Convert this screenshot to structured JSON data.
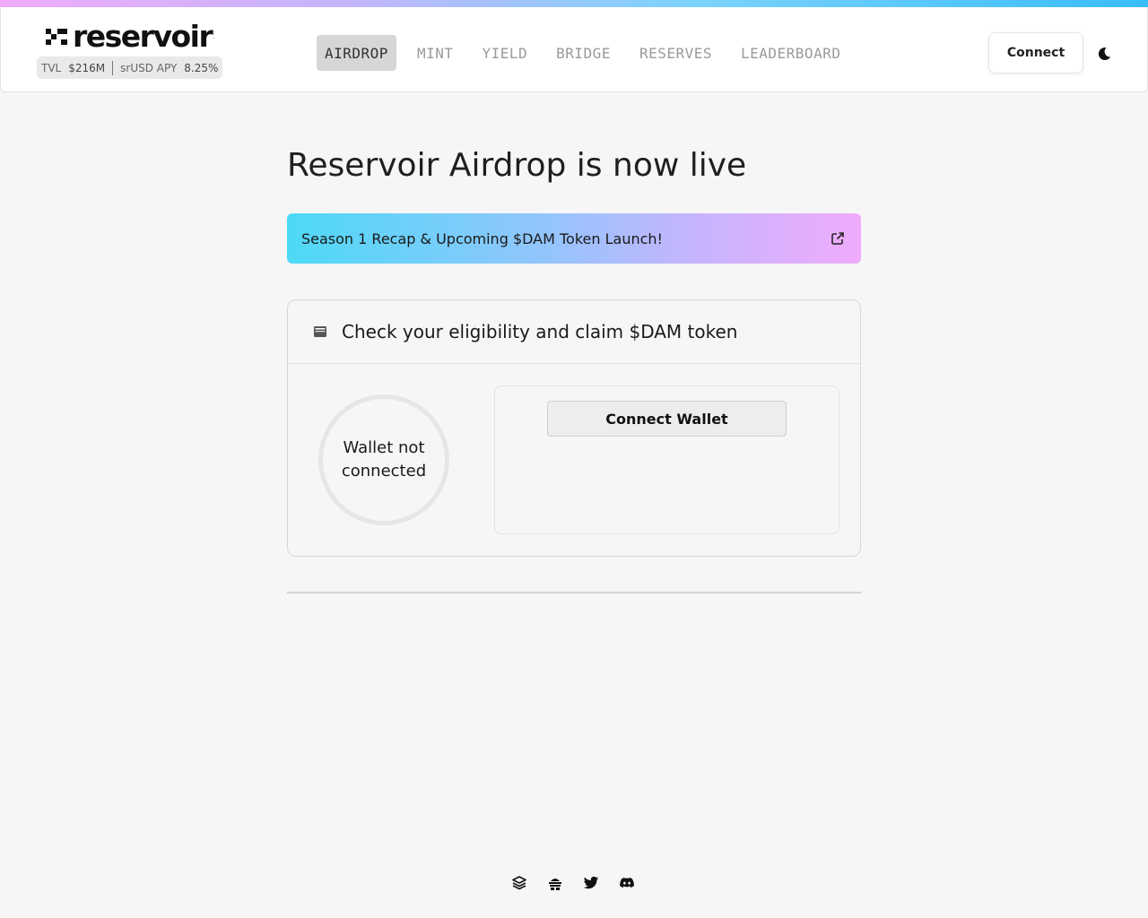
{
  "brand": {
    "name": "reservoir",
    "dot": "."
  },
  "stats": {
    "tvl_label": "TVL",
    "tvl_value": "$216M",
    "apy_label": "srUSD APY",
    "apy_value": "8.25%"
  },
  "nav": {
    "items": [
      {
        "label": "AIRDROP",
        "active": true
      },
      {
        "label": "MINT"
      },
      {
        "label": "YIELD"
      },
      {
        "label": "BRIDGE"
      },
      {
        "label": "RESERVES"
      },
      {
        "label": "LEADERBOARD"
      }
    ]
  },
  "header": {
    "connect_label": "Connect",
    "theme_icon": "moon-icon"
  },
  "page": {
    "title": "Reservoir Airdrop is now live",
    "banner_text": "Season 1 Recap & Upcoming $DAM Token Launch!",
    "banner_icon": "external-link-icon"
  },
  "eligibility": {
    "title": "Check your eligibility and claim $DAM token",
    "icon": "wallet-icon",
    "status_text": "Wallet not connected",
    "connect_wallet_label": "Connect Wallet"
  },
  "footer": {
    "socials": [
      "docs-icon",
      "forum-icon",
      "twitter-icon",
      "discord-icon"
    ]
  },
  "colors": {
    "background": "#f6f6f6",
    "gradient_start": "#4dd9f7",
    "gradient_end": "#f0abfc",
    "nav_active_bg": "#d6d6d6"
  }
}
